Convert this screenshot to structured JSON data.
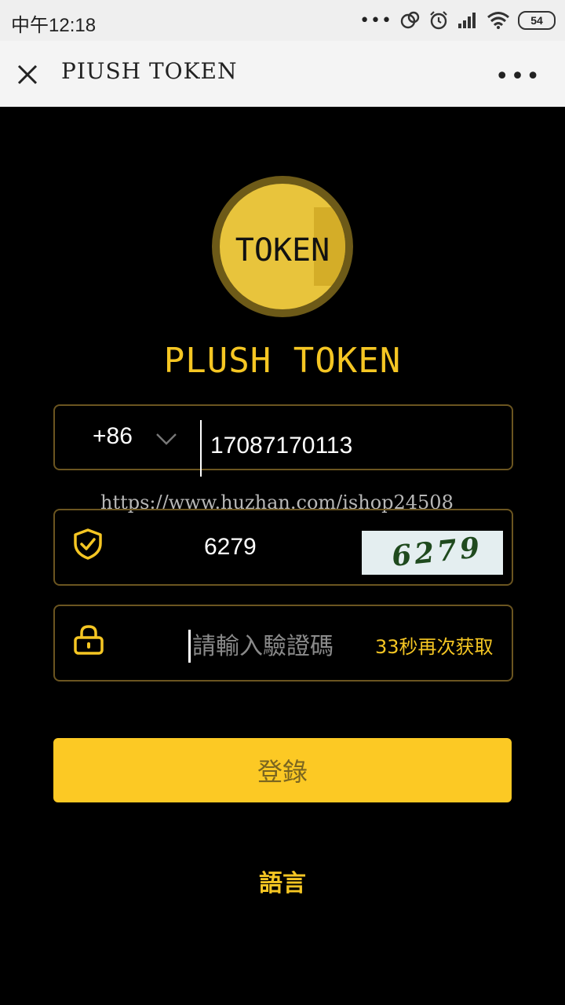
{
  "status_bar": {
    "time": "中午12:18",
    "battery": "54",
    "icons": [
      "more-dots-icon",
      "data-saver-icon",
      "alarm-icon",
      "signal-icon",
      "wifi-icon",
      "battery-icon"
    ]
  },
  "title_bar": {
    "title": "PIUSH TOKEN",
    "close_icon": "close-icon",
    "more_icon": "more-icon"
  },
  "logo": {
    "text": "TOKEN"
  },
  "app_name": "PLUSH TOKEN",
  "phone": {
    "country_code": "+86",
    "value": "17087170113"
  },
  "watermark": "https://www.huzhan.com/ishop24508",
  "captcha": {
    "value": "6279",
    "image_text": "6279"
  },
  "verify_code": {
    "placeholder": "請輸入驗證碼",
    "resend_label": "33秒再次获取"
  },
  "login_label": "登錄",
  "language_label": "語言",
  "colors": {
    "accent": "#f5c623",
    "button": "#fcc924",
    "border": "#6b5520",
    "background": "#000000"
  }
}
